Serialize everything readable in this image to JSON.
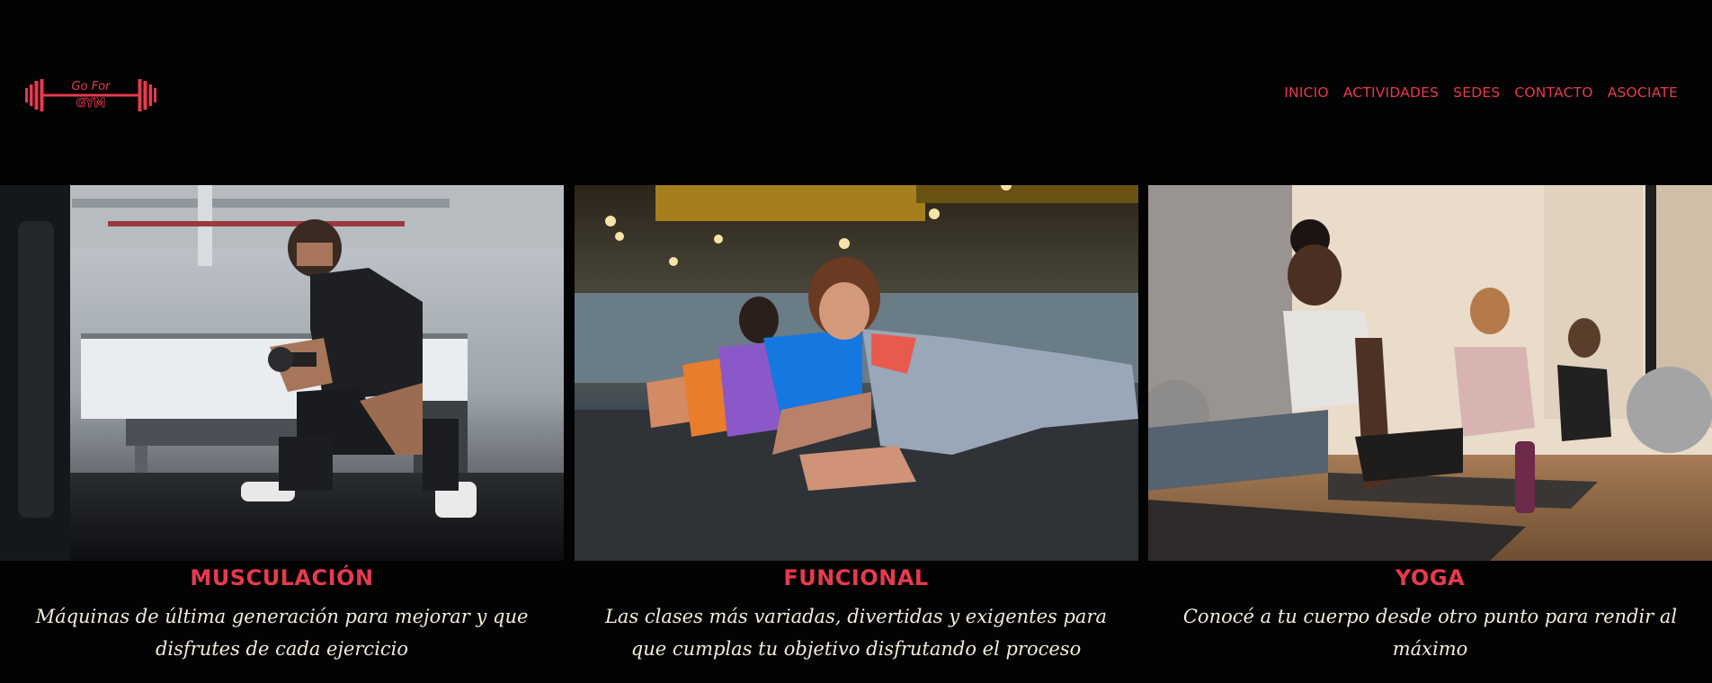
{
  "brand": {
    "logo_line1": "Go For",
    "logo_line2": "GYM",
    "accent_color": "#e63a4e",
    "background_color": "#030303",
    "text_color": "#f3ecdc"
  },
  "nav": {
    "items": [
      {
        "label": "INICIO"
      },
      {
        "label": "ACTIVIDADES"
      },
      {
        "label": "SEDES"
      },
      {
        "label": "CONTACTO"
      },
      {
        "label": "ASOCIATE"
      }
    ]
  },
  "cards": [
    {
      "title": "MUSCULACIÓN",
      "description": "Máquinas de última generación para mejorar y que disfrutes de cada ejercicio",
      "image": "gym-weights-photo"
    },
    {
      "title": "FUNCIONAL",
      "description": "Las clases más variadas, divertidas y exigentes para que cumplas tu objetivo disfrutando el proceso",
      "image": "functional-plank-class-photo"
    },
    {
      "title": "YOGA",
      "description": "Conocé a tu cuerpo desde otro punto para rendir al máximo",
      "image": "yoga-class-photo"
    }
  ]
}
